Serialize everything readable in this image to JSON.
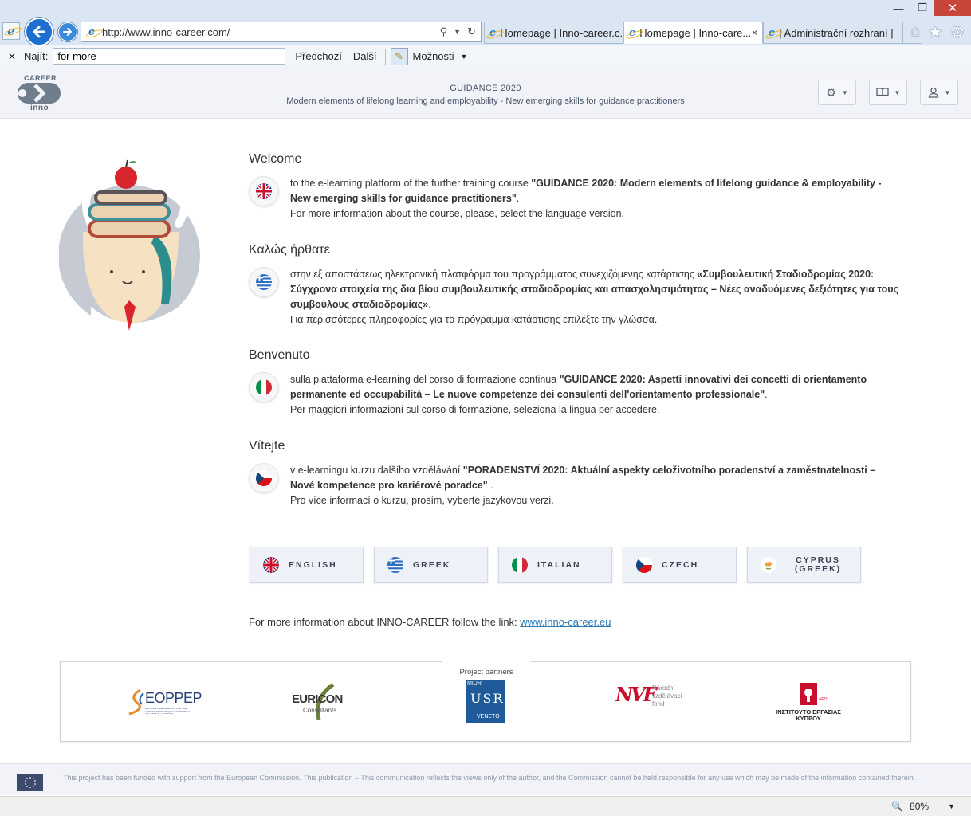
{
  "browser": {
    "address": "http://www.inno-career.com/",
    "tabs": [
      {
        "title": "Homepage | Inno-career.c..."
      },
      {
        "title": "Homepage | Inno-care...",
        "close": "×"
      },
      {
        "title": "| Administrační rozhraní |"
      }
    ],
    "find_label": "Najít:",
    "find_value": "for more",
    "find_prev": "Předchozí",
    "find_next": "Další",
    "find_options": "Možnosti",
    "zoom": "80%"
  },
  "header": {
    "logo_top": "CAREER",
    "logo_bottom": "inno",
    "title": "GUIDANCE 2020",
    "subtitle": "Modern elements of lifelong learning and employability - New emerging skills for guidance practitioners"
  },
  "sections": [
    {
      "title": "Welcome",
      "text1": "to the e-learning platform of the further training course ",
      "bold": "\"GUIDANCE 2020: Modern elements of lifelong guidance & employability - New emerging skills for guidance practitioners\"",
      "text2": ".",
      "line2": "For more information about the course, please, select the language version."
    },
    {
      "title": "Καλώς ήρθατε",
      "text1": "στην εξ αποστάσεως ηλεκτρονική πλατφόρμα του προγράμματος συνεχιζόμενης κατάρτισης ",
      "bold": "«Συμβουλευτική Σταδιοδρομίας 2020: Σύγχρονα στοιχεία της δια βίου συμβουλευτικής σταδιοδρομίας και απασχολησιμότητας – Νέες αναδυόμενες δεξιότητες για τους συμβούλους σταδιοδρομίας»",
      "text2": ".",
      "line2": "Για περισσότερες πληροφορίες για το πρόγραμμα κατάρτισης επιλέξτε την γλώσσα."
    },
    {
      "title": "Benvenuto",
      "text1": "sulla piattaforma e-learning del corso di formazione continua ",
      "bold": "\"GUIDANCE 2020: Aspetti innovativi dei concetti di orientamento permanente ed occupabilità – Le nuove competenze dei consulenti dell'orientamento professionale\"",
      "text2": ".",
      "line2": "Per maggiori informazioni sul corso di formazione, seleziona la lingua per accedere."
    },
    {
      "title": "Vítejte",
      "text1": "v e-learningu kurzu dalšího vzdělávání ",
      "bold": "\"PORADENSTVÍ 2020: Aktuální aspekty celoživotního poradenství a zaměstnatelnosti – Nové kompetence pro kariérové poradce\"",
      "text2": " .",
      "line2": "Pro více informací o kurzu, prosím, vyberte jazykovou verzi."
    }
  ],
  "languages": [
    "ENGLISH",
    "GREEK",
    "ITALIAN",
    "CZECH",
    "CYPRUS",
    "(GREEK)"
  ],
  "more_info": {
    "text": "For more information about INNO-CAREER follow the link: ",
    "link": "www.inno-career.eu"
  },
  "partners": {
    "label": "Project partners",
    "eoppep": "EOPPEP",
    "eoppep_sub": "NATIONAL ORGANISATION FOR THE CERTIFICATION OF QUALIFICATIONS & VOCATIONAL GUIDANCE",
    "euricon": "EURICON",
    "euricon_sub": "Consultants",
    "miur_top": "MIUR",
    "miur_mid": "USR",
    "miur_bottom": "VENETO",
    "nvf_letters": "NVF",
    "nvf_line1": "Národní",
    "nvf_line2": "vzdělávací",
    "nvf_line3": "fond",
    "cy_small": "ΑΕΟ",
    "cy_line1": "ΙΝΣΤΙΤΟΥΤΟ ΕΡΓΑΣΙΑΣ",
    "cy_line2": "ΚΥΠΡΟΥ"
  },
  "footer": {
    "text": "This project has been funded with support from the European Commission. This publication – This communication reflects the views only of the author, and the Commission cannot be held responsible for any use which may be made of the information contained therein."
  },
  "colors": {
    "header_bg": "#f1f3f8",
    "accent": "#2a7ab8",
    "tie": "#d8262c"
  }
}
